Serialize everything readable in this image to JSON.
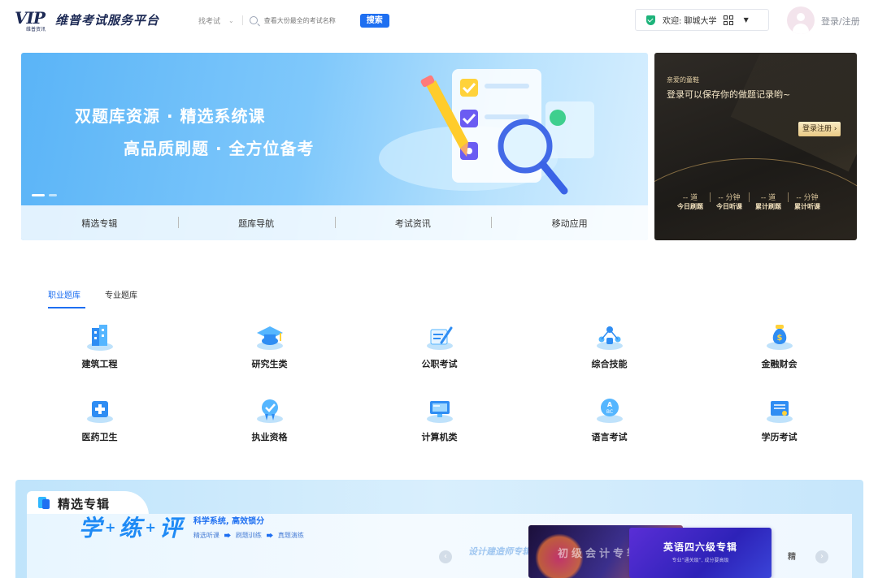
{
  "header": {
    "logo_text": "VIP",
    "logo_sub": "维普资讯",
    "site_title": "维普考试服务平台",
    "search_category": "找考试",
    "search_placeholder": "查看大份最全的考试名称",
    "search_button": "搜索",
    "welcome_text": "欢迎: 聊城大学",
    "login_link": "登录/注册"
  },
  "banner": {
    "line1": "双题库资源 · 精选系统课",
    "line2": "高品质刷题 · 全方位备考",
    "nav": [
      "精选专辑",
      "题库导航",
      "考试资讯",
      "移动应用"
    ]
  },
  "promo": {
    "greeting": "亲爱的童鞋",
    "message": "登录可以保存你的做题记录哟~",
    "button": "登录注册 ›",
    "stats": [
      {
        "value": "-- 道",
        "label": "今日刷题"
      },
      {
        "value": "-- 分钟",
        "label": "今日听课"
      },
      {
        "value": "-- 道",
        "label": "累计刷题"
      },
      {
        "value": "-- 分钟",
        "label": "累计听课"
      }
    ]
  },
  "tabs": [
    {
      "label": "职业题库",
      "active": true
    },
    {
      "label": "专业题库",
      "active": false
    }
  ],
  "categories": [
    {
      "label": "建筑工程",
      "icon": "building-icon"
    },
    {
      "label": "研究生类",
      "icon": "graduation-cap-icon"
    },
    {
      "label": "公职考试",
      "icon": "document-pen-icon"
    },
    {
      "label": "综合技能",
      "icon": "skills-network-icon"
    },
    {
      "label": "金融财会",
      "icon": "money-bag-icon"
    },
    {
      "label": "医药卫生",
      "icon": "medical-kit-icon"
    },
    {
      "label": "执业资格",
      "icon": "certificate-icon"
    },
    {
      "label": "计算机类",
      "icon": "computer-icon"
    },
    {
      "label": "语言考试",
      "icon": "language-abc-icon"
    },
    {
      "label": "学历考试",
      "icon": "diploma-icon"
    }
  ],
  "featured": {
    "title": "精选专辑",
    "slogan": [
      "学",
      "练",
      "评"
    ],
    "slogan_plus": "+",
    "sub_title": "科学系统, 高效锁分",
    "sub_steps": [
      "精选听课",
      "刷题训练",
      "真题演练"
    ],
    "cards": [
      {
        "title": "设计建造师专辑"
      },
      {
        "title": "初级会计专辑"
      },
      {
        "title": "英语四六级专辑",
        "subtitle": "专业“通关级”, 成分要高级"
      },
      {
        "title": "精"
      }
    ],
    "prev_icon": "‹",
    "next_icon": "›"
  },
  "colors": {
    "accent": "#1e6ff1",
    "brand_dark": "#1d2a55",
    "success": "#1db37a",
    "gold": "#e9c985"
  }
}
